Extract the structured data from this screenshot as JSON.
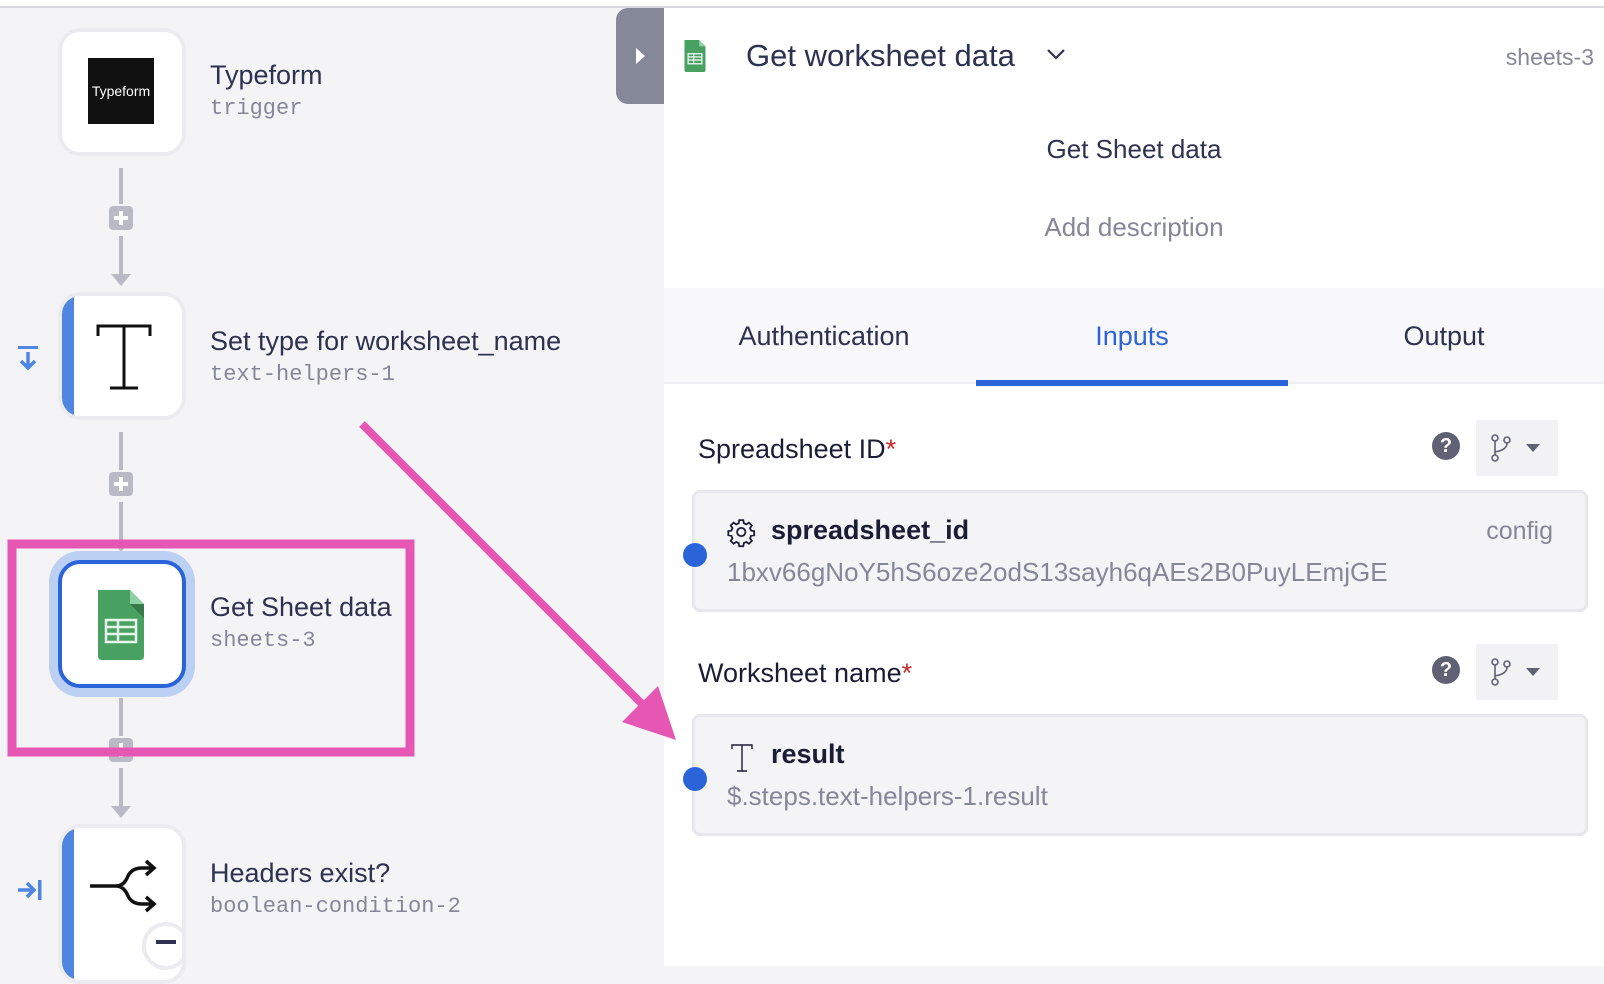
{
  "canvas": {
    "collapse_tab_icon": "chevron-right-icon",
    "nodes": [
      {
        "title": "Typeform",
        "subtitle": "trigger",
        "logo_text": "Typeform",
        "icon": "typeform-logo"
      },
      {
        "title": "Set type for worksheet_name",
        "subtitle": "text-helpers-1",
        "icon": "text-type-icon",
        "side_icon": "step-into-icon"
      },
      {
        "title": "Get Sheet data",
        "subtitle": "sheets-3",
        "icon": "google-sheets-icon",
        "selected": true
      },
      {
        "title": "Headers exist?",
        "subtitle": "boolean-condition-2",
        "icon": "branch-split-icon",
        "side_icon": "skip-to-end-icon"
      }
    ]
  },
  "panel": {
    "header": {
      "icon": "google-sheets-icon",
      "title": "Get worksheet data",
      "step_id": "sheets-3"
    },
    "step_name": "Get Sheet data",
    "description_placeholder": "Add description",
    "tabs": [
      {
        "label": "Authentication",
        "active": false
      },
      {
        "label": "Inputs",
        "active": true
      },
      {
        "label": "Output",
        "active": false
      }
    ],
    "fields": [
      {
        "label": "Spreadsheet ID",
        "required_mark": "*",
        "variable_icon": "gear-icon",
        "variable_name": "spreadsheet_id",
        "variable_source": "config",
        "value": "1bxv66gNoY5hS6oze2odS13sayh6qAEs2B0PuyLEmjGE"
      },
      {
        "label": "Worksheet name",
        "required_mark": "*",
        "variable_icon": "text-type-icon",
        "variable_name": "result",
        "variable_source": "",
        "value": "$.steps.text-helpers-1.result"
      }
    ]
  },
  "colors": {
    "accent": "#2b63d9",
    "annotation": "#e657b4",
    "required": "#c62b2b"
  }
}
